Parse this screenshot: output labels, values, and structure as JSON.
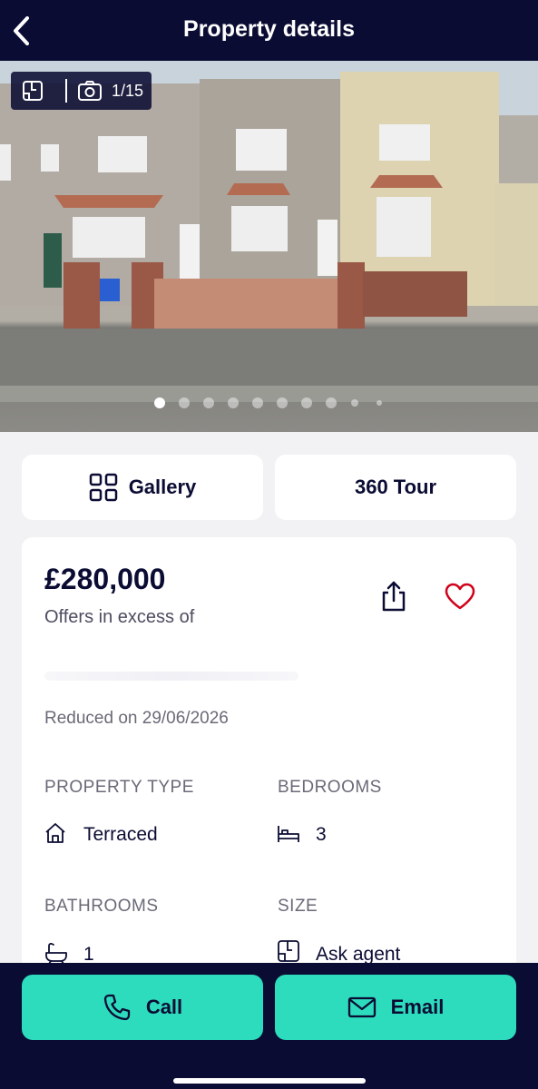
{
  "header": {
    "title": "Property details",
    "back_icon": "chevron-left-icon"
  },
  "gallery_badge": {
    "floorplan_icon": "floorplan-icon",
    "camera_icon": "camera-icon",
    "counter": "1/15"
  },
  "carousel": {
    "total_dots": 10,
    "active_index": 0
  },
  "media_buttons": {
    "gallery_label": "Gallery",
    "gallery_icon": "grid-icon",
    "tour_label": "360 Tour"
  },
  "listing": {
    "price": "£280,000",
    "price_qualifier": "Offers in excess of",
    "reduced": "Reduced on 29/06/2026",
    "share_icon": "share-icon",
    "favourite_icon": "heart-icon",
    "favourite_color": "#d0021b"
  },
  "attributes": [
    {
      "label": "PROPERTY TYPE",
      "value": "Terraced",
      "icon": "house-icon"
    },
    {
      "label": "BEDROOMS",
      "value": "3",
      "icon": "bed-icon"
    },
    {
      "label": "BATHROOMS",
      "value": "1",
      "icon": "bath-icon"
    },
    {
      "label": "SIZE",
      "value": "Ask agent",
      "icon": "floorplan-icon"
    }
  ],
  "actions": {
    "call_label": "Call",
    "call_icon": "phone-icon",
    "email_label": "Email",
    "email_icon": "mail-icon"
  },
  "colors": {
    "navy": "#0b0c33",
    "accent": "#2ddcbd",
    "background": "#f2f2f5"
  }
}
